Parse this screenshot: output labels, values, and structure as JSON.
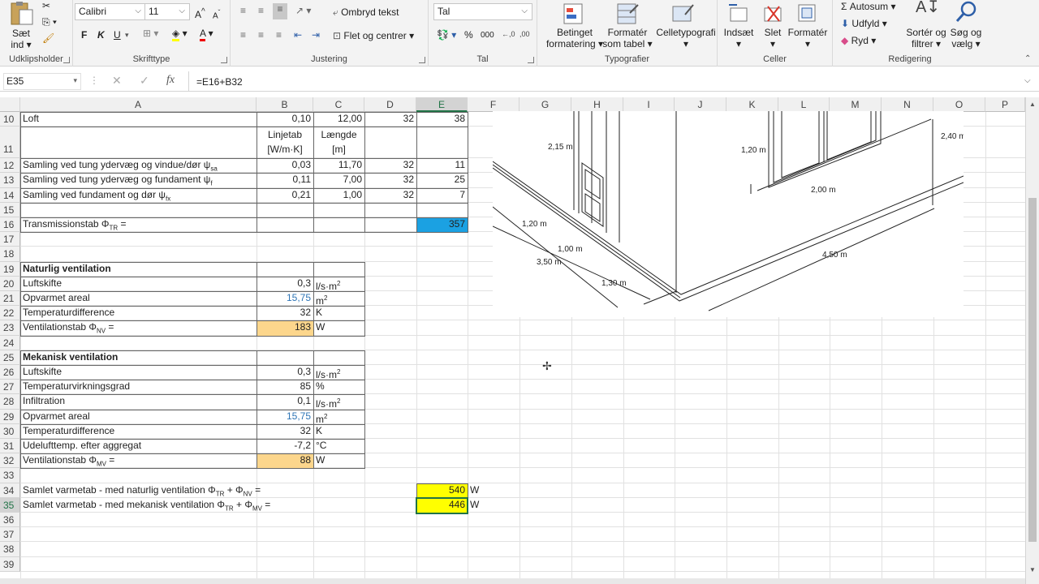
{
  "ribbon": {
    "clipboard": {
      "paste_label_1": "Sæt",
      "paste_label_2": "ind",
      "group": "Udklipsholder"
    },
    "font": {
      "name": "Calibri",
      "size": "11",
      "bold": "F",
      "italic": "K",
      "underline": "U",
      "group": "Skrifttype"
    },
    "alignment": {
      "wrap": "Ombryd tekst",
      "merge": "Flet og centrer",
      "group": "Justering"
    },
    "number": {
      "format": "Tal",
      "percent": "%",
      "thousands": "000",
      "group": "Tal"
    },
    "styles": {
      "conditional_1": "Betinget",
      "conditional_2": "formatering",
      "table_1": "Formatér",
      "table_2": "som tabel",
      "cell_styles": "Celletypografi",
      "group": "Typografier"
    },
    "cells": {
      "insert": "Indsæt",
      "delete": "Slet",
      "format": "Formatér",
      "group": "Celler"
    },
    "editing": {
      "autosum": "Autosum",
      "fill": "Udfyld",
      "clear": "Ryd",
      "sort_1": "Sortér og",
      "sort_2": "filtrer",
      "find_1": "Søg og",
      "find_2": "vælg",
      "group": "Redigering"
    }
  },
  "formula_bar": {
    "name_box": "E35",
    "fx": "fx",
    "formula": "=E16+B32"
  },
  "columns": [
    "A",
    "B",
    "C",
    "D",
    "E",
    "F",
    "G",
    "H",
    "I",
    "J",
    "K",
    "L",
    "M",
    "N",
    "O",
    "P"
  ],
  "rows": [
    "10",
    "11",
    "12",
    "13",
    "14",
    "15",
    "16",
    "17",
    "18",
    "19",
    "20",
    "21",
    "22",
    "23",
    "24",
    "25",
    "26",
    "27",
    "28",
    "29",
    "30",
    "31",
    "32",
    "33",
    "34",
    "35",
    "36",
    "37",
    "38",
    "39"
  ],
  "cells": {
    "r10": {
      "a": "Loft",
      "b": "0,10",
      "c": "12,00",
      "d": "32",
      "e": "38"
    },
    "r11": {
      "b1": "Linjetab",
      "b2": "[W/m·K]",
      "c1": "Længde",
      "c2": "[m]"
    },
    "r12": {
      "a": "Samling ved tung ydervæg og vindue/dør ψ",
      "a_sub": "sa",
      "b": "0,03",
      "c": "11,70",
      "d": "32",
      "e": "11"
    },
    "r13": {
      "a": "Samling ved tung ydervæg og fundament ψ",
      "a_sub": "f",
      "b": "0,11",
      "c": "7,00",
      "d": "32",
      "e": "25"
    },
    "r14": {
      "a": "Samling ved fundament og dør ψ",
      "a_sub": "fx",
      "b": "0,21",
      "c": "1,00",
      "d": "32",
      "e": "7"
    },
    "r16": {
      "a": "Transmissionstab Φ",
      "a_sub": "TR",
      "a_tail": " =",
      "e": "357"
    },
    "r19": {
      "a": "Naturlig ventilation"
    },
    "r20": {
      "a": "Luftskifte",
      "b": "0,3",
      "c": "l/s·m",
      "c_sup": "2"
    },
    "r21": {
      "a": "Opvarmet areal",
      "b": "15,75",
      "c": "m",
      "c_sup": "2"
    },
    "r22": {
      "a": "Temperaturdifference",
      "b": "32",
      "c": "K"
    },
    "r23": {
      "a": "Ventilationstab Φ",
      "a_sub": "NV",
      "a_tail": " =",
      "b": "183",
      "c": "W"
    },
    "r25": {
      "a": "Mekanisk ventilation"
    },
    "r26": {
      "a": "Luftskifte",
      "b": "0,3",
      "c": "l/s·m",
      "c_sup": "2"
    },
    "r27": {
      "a": "Temperaturvirkningsgrad",
      "b": "85",
      "c": "%"
    },
    "r28": {
      "a": "Infiltration",
      "b": "0,1",
      "c": "l/s·m",
      "c_sup": "2"
    },
    "r29": {
      "a": "Opvarmet areal",
      "b": "15,75",
      "c": "m",
      "c_sup": "2"
    },
    "r30": {
      "a": "Temperaturdifference",
      "b": "32",
      "c": "K"
    },
    "r31": {
      "a": "Udelufttemp. efter aggregat",
      "b": "-7,2",
      "c": "°C"
    },
    "r32": {
      "a": "Ventilationstab Φ",
      "a_sub": "MV",
      "a_tail": " =",
      "b": "88",
      "c": "W"
    },
    "r34": {
      "a": "Samlet varmetab - med naturlig ventilation Φ",
      "a_sub1": "TR",
      "a_mid": " + Φ",
      "a_sub2": "NV",
      "a_tail": " =",
      "e": "540",
      "f": "W"
    },
    "r35": {
      "a": "Samlet varmetab - med mekanisk ventilation Φ",
      "a_sub1": "TR",
      "a_mid": " + Φ",
      "a_sub2": "MV",
      "a_tail": " =",
      "e": "446",
      "f": "W"
    }
  },
  "drawing": {
    "d1": "2,15 m",
    "d2": "1,20 m",
    "d3": "2,40 m",
    "d4": "2,00 m",
    "d5": "1,20 m",
    "d6": "1,00 m",
    "d7": "3,50 m",
    "d8": "1,30 m",
    "d9": "4,50 m"
  },
  "colors": {
    "accent": "#217346",
    "blue_fill": "#1ba1e2",
    "orange_fill": "#fcd68c",
    "yellow_fill": "#ffff00",
    "blue_text": "#2e75b6"
  }
}
